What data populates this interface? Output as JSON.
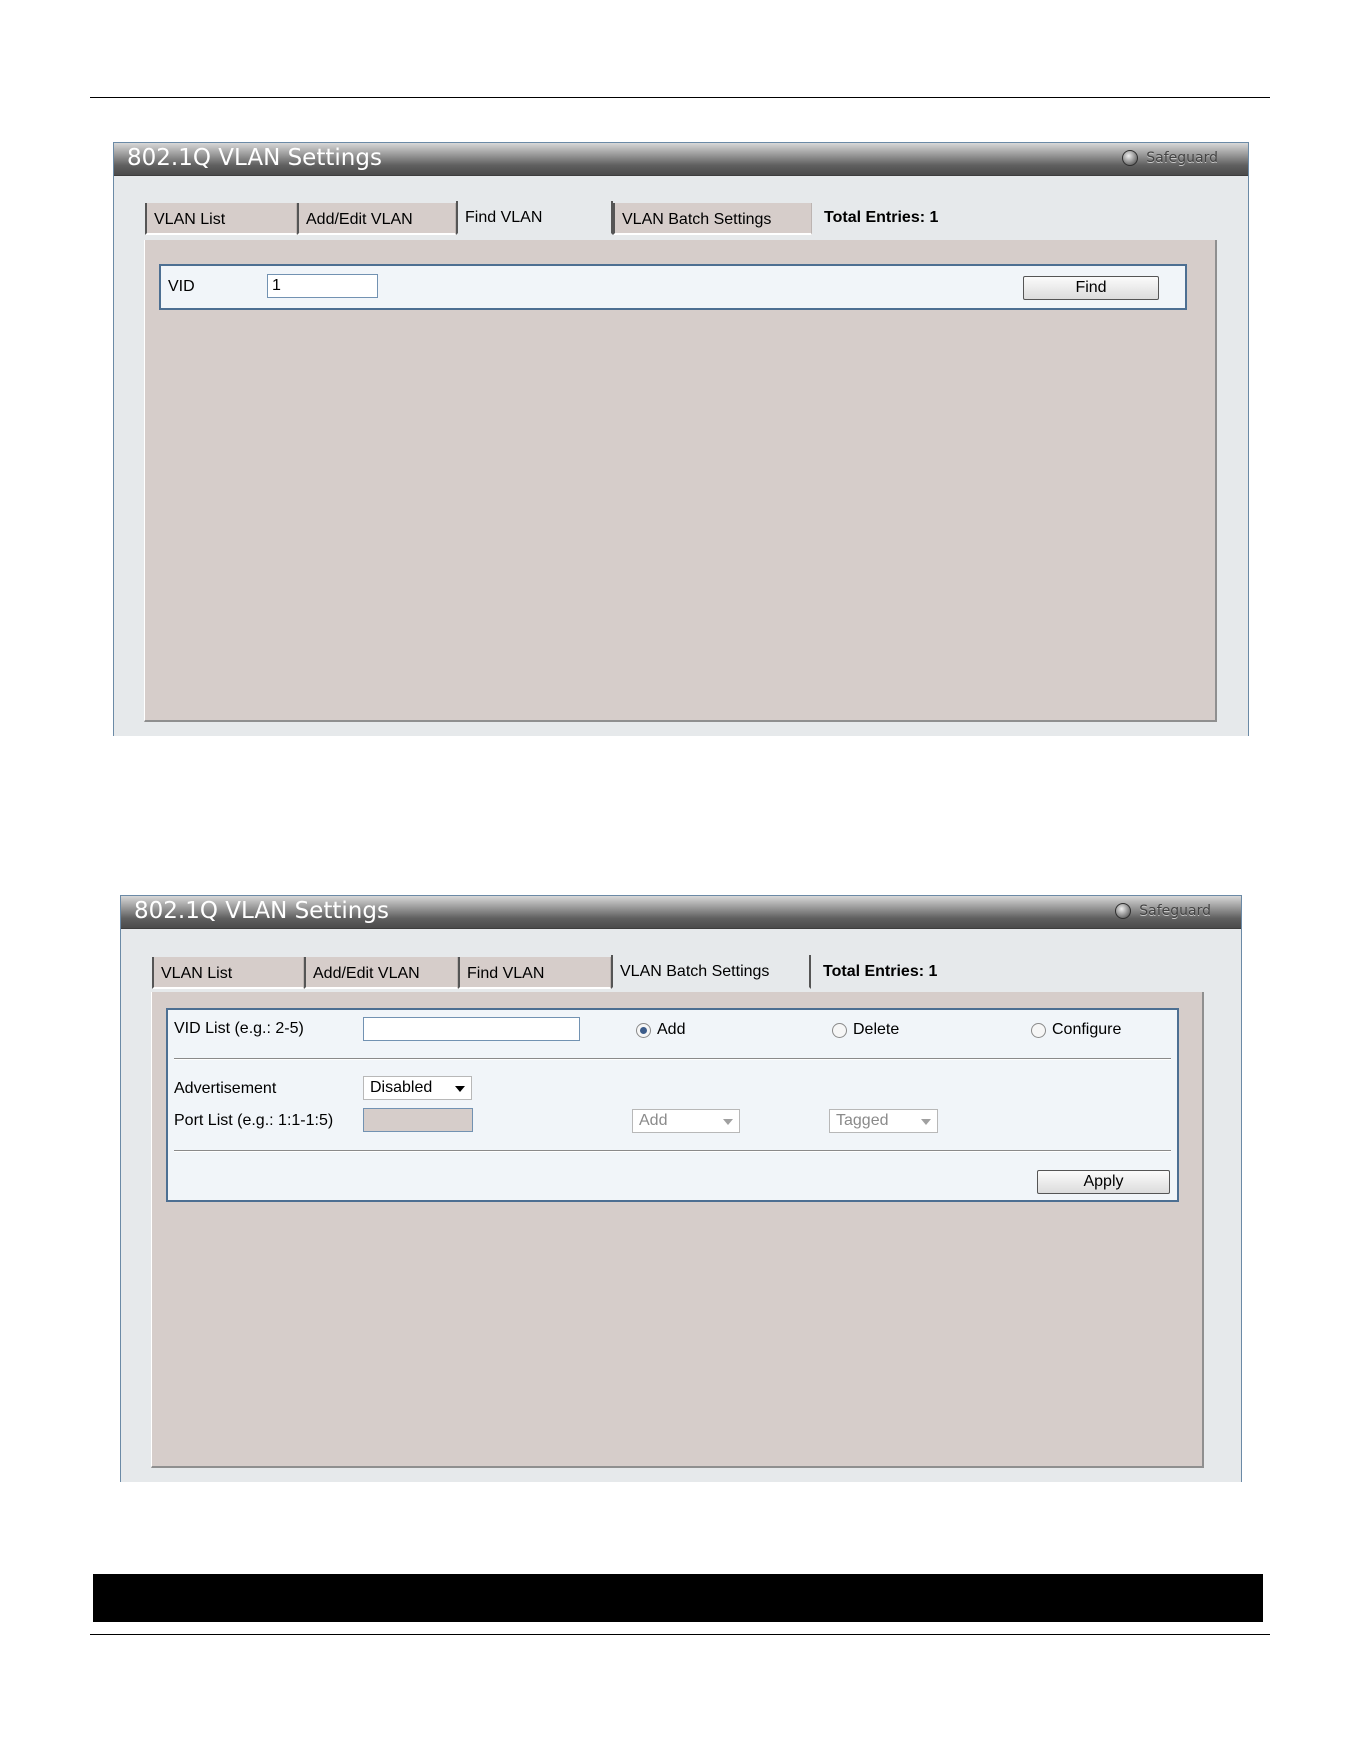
{
  "panel1": {
    "title": "802.1Q VLAN Settings",
    "safeguard": "Safeguard",
    "tabs": [
      "VLAN List",
      "Add/Edit VLAN",
      "Find VLAN",
      "VLAN Batch Settings"
    ],
    "active_tab": "Find VLAN",
    "total_entries": "Total Entries: 1",
    "vid_label": "VID",
    "vid_value": "1",
    "find_button": "Find"
  },
  "panel2": {
    "title": "802.1Q VLAN Settings",
    "safeguard": "Safeguard",
    "tabs": [
      "VLAN List",
      "Add/Edit VLAN",
      "Find VLAN",
      "VLAN Batch Settings"
    ],
    "active_tab": "VLAN Batch Settings",
    "total_entries": "Total Entries: 1",
    "vid_list_label": "VID List (e.g.: 2-5)",
    "vid_list_value": "",
    "radio_add": "Add",
    "radio_delete": "Delete",
    "radio_configure": "Configure",
    "selected_radio": "Add",
    "advertisement_label": "Advertisement",
    "advertisement_value": "Disabled",
    "port_list_label": "Port List (e.g.: 1:1-1:5)",
    "port_action_value": "Add",
    "port_tag_value": "Tagged",
    "apply_button": "Apply"
  },
  "colors": {
    "form_border": "#4d6f92",
    "content_bg": "#d6cdca",
    "header_dark": "#4b4b4b"
  }
}
